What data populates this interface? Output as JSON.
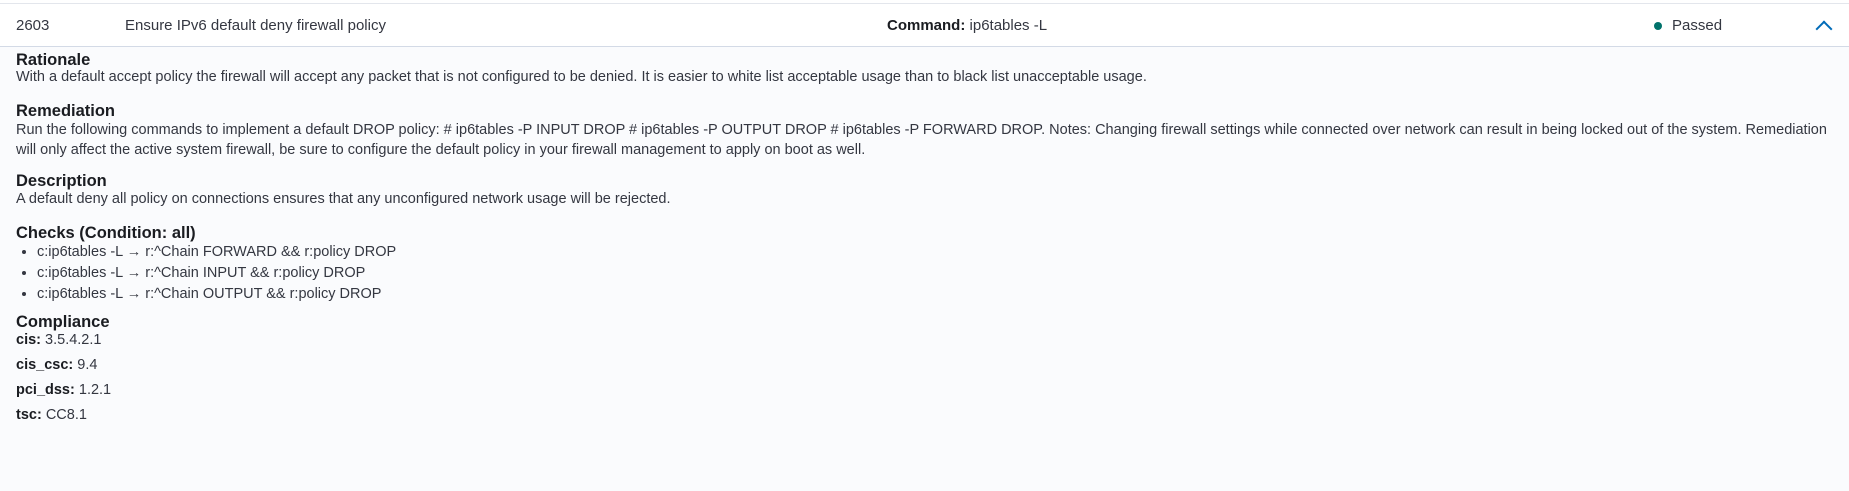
{
  "rule": {
    "id": "2603",
    "title": "Ensure IPv6 default deny firewall policy",
    "command_label": "Command:",
    "command_value": "ip6tables -L",
    "status": "Passed",
    "status_color": "#00726b"
  },
  "details": {
    "rationale_heading": "Rationale",
    "rationale_text": "With a default accept policy the firewall will accept any packet that is not configured to be denied. It is easier to white list acceptable usage than to black list unacceptable usage.",
    "remediation_heading": "Remediation",
    "remediation_text": "Run the following commands to implement a default DROP policy: # ip6tables -P INPUT DROP # ip6tables -P OUTPUT DROP # ip6tables -P FORWARD DROP. Notes: Changing firewall settings while connected over network can result in being locked out of the system. Remediation will only affect the active system firewall, be sure to configure the default policy in your firewall management to apply on boot as well.",
    "description_heading": "Description",
    "description_text": "A default deny all policy on connections ensures that any unconfigured network usage will be rejected.",
    "checks_heading": "Checks (Condition: all)",
    "checks": [
      "c:ip6tables -L → r:^Chain FORWARD && r:policy DROP",
      "c:ip6tables -L → r:^Chain INPUT && r:policy DROP",
      "c:ip6tables -L → r:^Chain OUTPUT && r:policy DROP"
    ],
    "compliance_heading": "Compliance",
    "compliance": [
      {
        "key": "cis:",
        "value": "3.5.4.2.1"
      },
      {
        "key": "cis_csc:",
        "value": "9.4"
      },
      {
        "key": "pci_dss:",
        "value": "1.2.1"
      },
      {
        "key": "tsc:",
        "value": "CC8.1"
      }
    ]
  },
  "icons": {
    "status": "status-dot-icon",
    "toggle": "chevron-up-icon"
  }
}
